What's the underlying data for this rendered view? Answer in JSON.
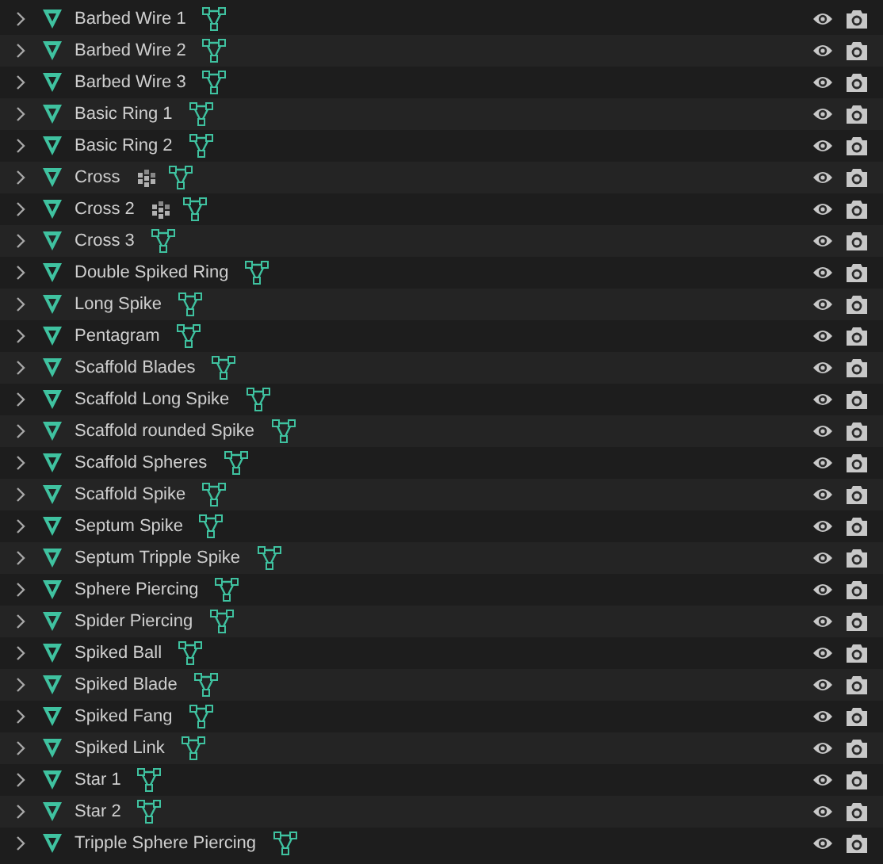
{
  "objects": [
    {
      "name": "Barbed Wire 1",
      "expanded": false,
      "modifier": false,
      "visible": true,
      "renderable": true
    },
    {
      "name": "Barbed Wire 2",
      "expanded": false,
      "modifier": false,
      "visible": true,
      "renderable": true
    },
    {
      "name": "Barbed Wire 3",
      "expanded": false,
      "modifier": false,
      "visible": true,
      "renderable": true
    },
    {
      "name": "Basic Ring 1",
      "expanded": false,
      "modifier": false,
      "visible": true,
      "renderable": true
    },
    {
      "name": "Basic Ring 2",
      "expanded": false,
      "modifier": false,
      "visible": true,
      "renderable": true
    },
    {
      "name": "Cross",
      "expanded": false,
      "modifier": true,
      "visible": true,
      "renderable": true
    },
    {
      "name": "Cross 2",
      "expanded": false,
      "modifier": true,
      "visible": true,
      "renderable": true
    },
    {
      "name": "Cross 3",
      "expanded": false,
      "modifier": false,
      "visible": true,
      "renderable": true
    },
    {
      "name": "Double Spiked Ring",
      "expanded": false,
      "modifier": false,
      "visible": true,
      "renderable": true
    },
    {
      "name": "Long Spike",
      "expanded": false,
      "modifier": false,
      "visible": true,
      "renderable": true
    },
    {
      "name": "Pentagram",
      "expanded": false,
      "modifier": false,
      "visible": true,
      "renderable": true
    },
    {
      "name": "Scaffold Blades",
      "expanded": false,
      "modifier": false,
      "visible": true,
      "renderable": true
    },
    {
      "name": "Scaffold Long Spike",
      "expanded": false,
      "modifier": false,
      "visible": true,
      "renderable": true
    },
    {
      "name": "Scaffold rounded Spike",
      "expanded": false,
      "modifier": false,
      "visible": true,
      "renderable": true
    },
    {
      "name": "Scaffold Spheres",
      "expanded": false,
      "modifier": false,
      "visible": true,
      "renderable": true
    },
    {
      "name": "Scaffold Spike",
      "expanded": false,
      "modifier": false,
      "visible": true,
      "renderable": true
    },
    {
      "name": "Septum Spike",
      "expanded": false,
      "modifier": false,
      "visible": true,
      "renderable": true
    },
    {
      "name": "Septum Tripple Spike",
      "expanded": false,
      "modifier": false,
      "visible": true,
      "renderable": true
    },
    {
      "name": "Sphere Piercing",
      "expanded": false,
      "modifier": false,
      "visible": true,
      "renderable": true
    },
    {
      "name": "Spider Piercing",
      "expanded": false,
      "modifier": false,
      "visible": true,
      "renderable": true
    },
    {
      "name": "Spiked Ball",
      "expanded": false,
      "modifier": false,
      "visible": true,
      "renderable": true
    },
    {
      "name": "Spiked Blade",
      "expanded": false,
      "modifier": false,
      "visible": true,
      "renderable": true
    },
    {
      "name": "Spiked Fang",
      "expanded": false,
      "modifier": false,
      "visible": true,
      "renderable": true
    },
    {
      "name": "Spiked Link",
      "expanded": false,
      "modifier": false,
      "visible": true,
      "renderable": true
    },
    {
      "name": "Star 1",
      "expanded": false,
      "modifier": false,
      "visible": true,
      "renderable": true
    },
    {
      "name": "Star 2",
      "expanded": false,
      "modifier": false,
      "visible": true,
      "renderable": true
    },
    {
      "name": "Tripple Sphere Piercing",
      "expanded": false,
      "modifier": false,
      "visible": true,
      "renderable": true
    }
  ]
}
